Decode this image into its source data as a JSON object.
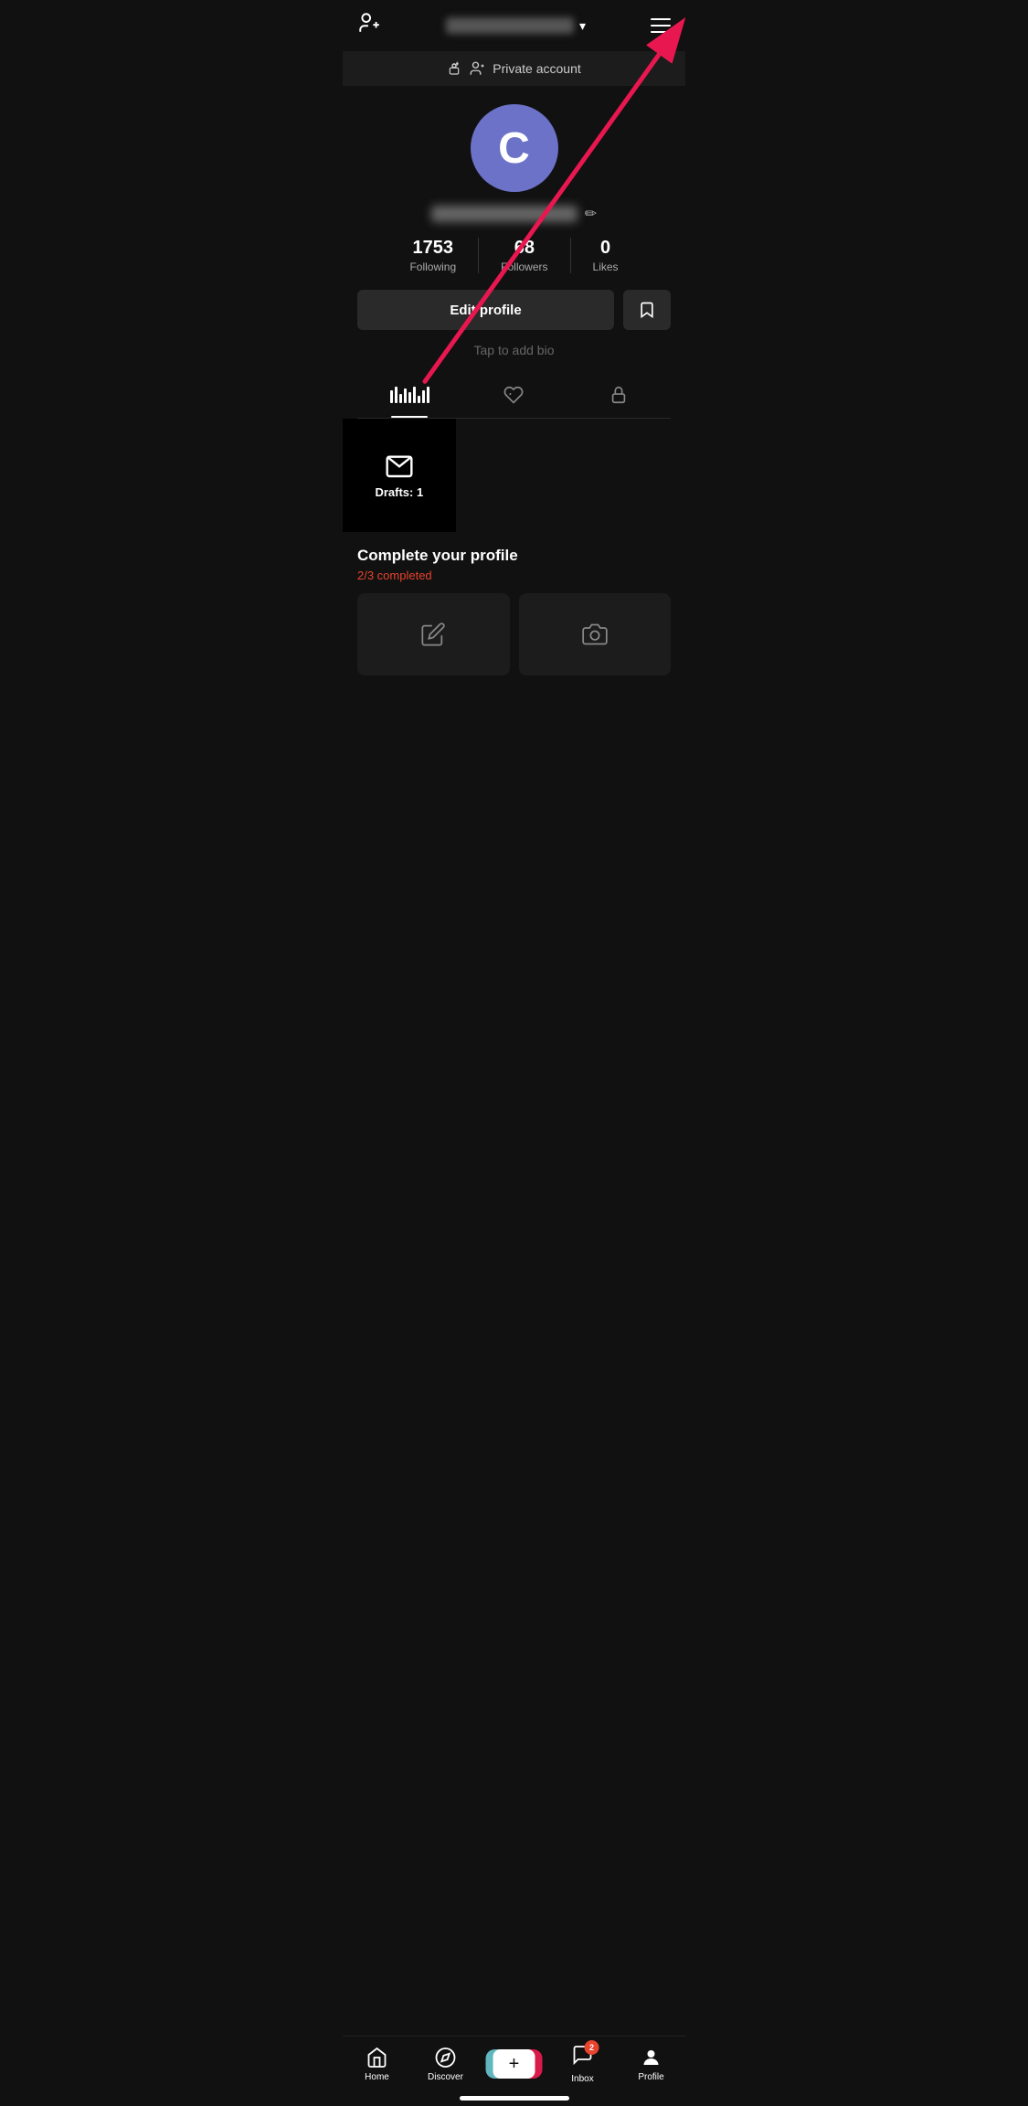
{
  "header": {
    "username_placeholder": "username blurred",
    "add_user_label": "add-user",
    "menu_label": "menu"
  },
  "private_banner": {
    "text": "Private account"
  },
  "profile": {
    "avatar_letter": "C",
    "avatar_color": "#6b72c8",
    "username_placeholder": "username blurred",
    "stats": [
      {
        "number": "1753",
        "label": "Following"
      },
      {
        "number": "68",
        "label": "Followers"
      },
      {
        "number": "0",
        "label": "Likes"
      }
    ],
    "edit_profile_label": "Edit profile",
    "bio_placeholder": "Tap to add bio",
    "drafts_label": "Drafts: 1"
  },
  "complete_profile": {
    "title": "Complete your profile",
    "subtitle": "2/3 completed"
  },
  "bottom_nav": {
    "items": [
      {
        "label": "Home",
        "icon": "home"
      },
      {
        "label": "Discover",
        "icon": "compass"
      },
      {
        "label": "",
        "icon": "create"
      },
      {
        "label": "Inbox",
        "icon": "inbox",
        "badge": "2"
      },
      {
        "label": "Profile",
        "icon": "profile"
      }
    ]
  }
}
